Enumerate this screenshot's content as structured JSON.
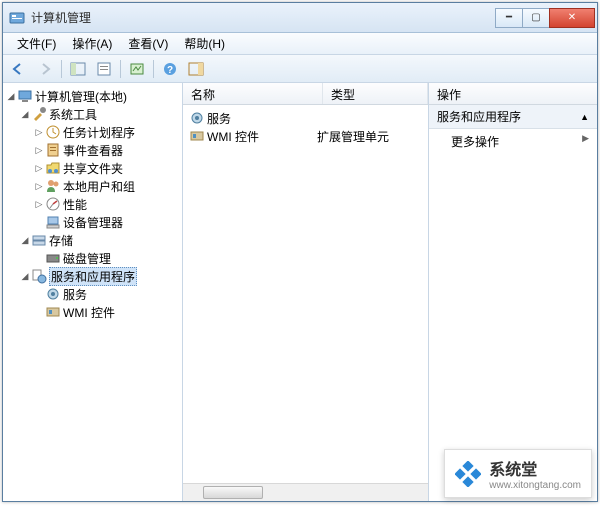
{
  "window": {
    "title": "计算机管理"
  },
  "menu": {
    "file": "文件(F)",
    "action": "操作(A)",
    "view": "查看(V)",
    "help": "帮助(H)"
  },
  "tree": {
    "root": "计算机管理(本地)",
    "system_tools": "系统工具",
    "task_scheduler": "任务计划程序",
    "event_viewer": "事件查看器",
    "shared_folders": "共享文件夹",
    "local_users": "本地用户和组",
    "performance": "性能",
    "device_manager": "设备管理器",
    "storage": "存储",
    "disk_management": "磁盘管理",
    "services_apps": "服务和应用程序",
    "services": "服务",
    "wmi": "WMI 控件"
  },
  "list": {
    "columns": {
      "name": "名称",
      "type": "类型"
    },
    "rows": [
      {
        "name": "服务",
        "type": ""
      },
      {
        "name": "WMI 控件",
        "type": "扩展管理单元"
      }
    ]
  },
  "actions": {
    "header": "操作",
    "section": "服务和应用程序",
    "more": "更多操作"
  },
  "watermark": {
    "brand": "系统堂",
    "url": "www.xitongtang.com"
  }
}
